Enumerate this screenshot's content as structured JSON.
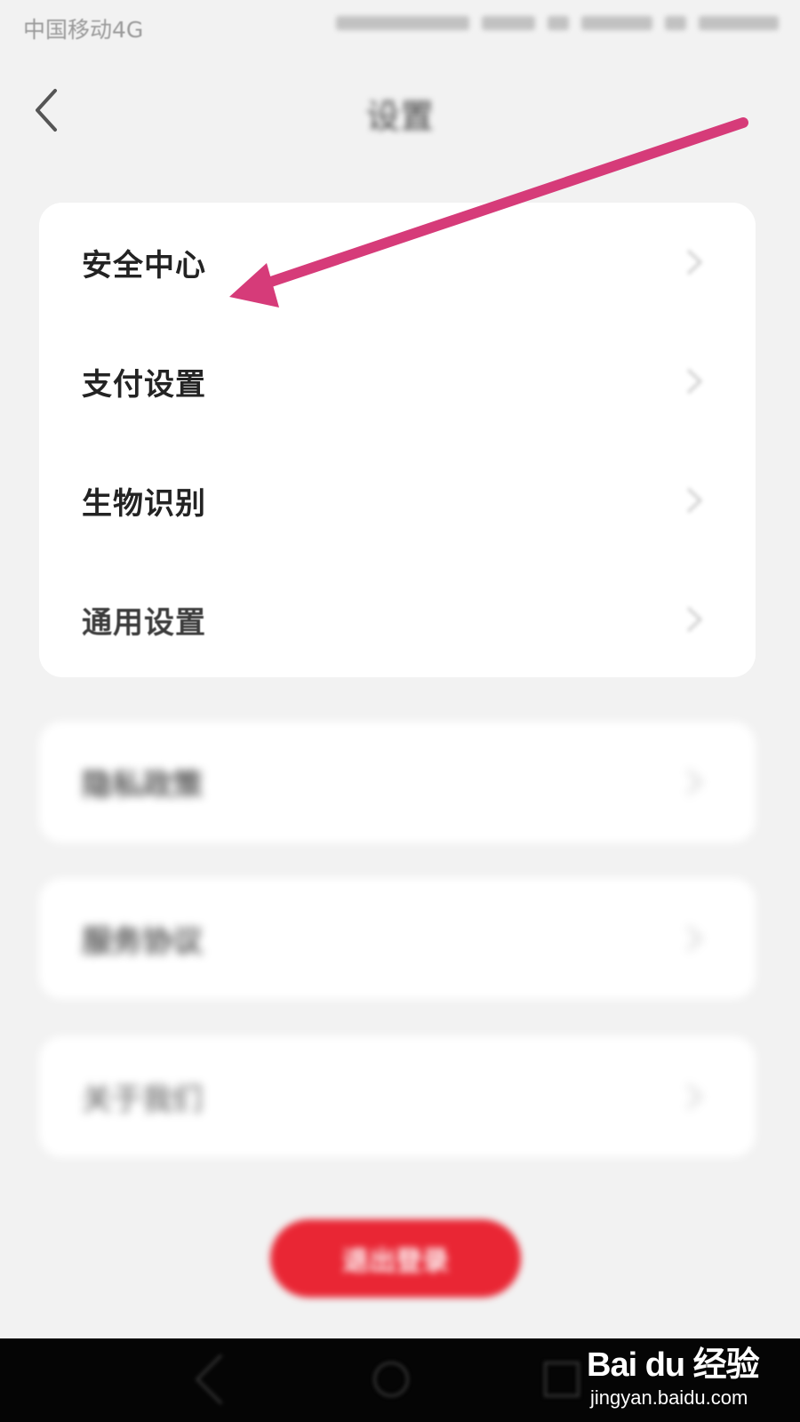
{
  "status_bar": {
    "carrier": "中国移动4G"
  },
  "nav": {
    "title": "设置",
    "back_icon": "chevron-left-icon"
  },
  "settings_group": {
    "items": [
      {
        "label": "安全中心"
      },
      {
        "label": "支付设置"
      },
      {
        "label": "生物识别"
      },
      {
        "label": "通用设置"
      }
    ]
  },
  "blurred_groups": [
    {
      "label": "隐私政策"
    },
    {
      "label": "服务协议"
    },
    {
      "label": "关于我们"
    }
  ],
  "logout_button": {
    "label": "退出登录",
    "color": "#e92634"
  },
  "annotation": {
    "arrow_color": "#d63b79",
    "points_to": "安全中心"
  },
  "watermark": {
    "brand": "Bai du 经验",
    "url": "jingyan.baidu.com"
  }
}
